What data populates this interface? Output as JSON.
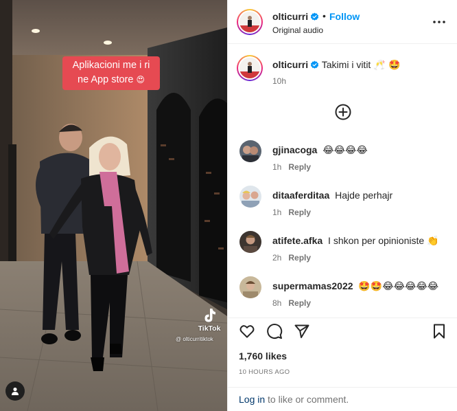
{
  "media": {
    "caption_sticker_line1": "Aplikacioni me i ri",
    "caption_sticker_line2": "ne App store",
    "caption_sticker_emoji": "😍",
    "watermark_brand": "TikTok",
    "watermark_handle": "@ olticurritiktok",
    "user_tag_icon": "person-icon"
  },
  "header": {
    "username": "olticurri",
    "separator": "•",
    "follow_label": "Follow",
    "audio": "Original audio",
    "more_icon": "more-horizontal-icon"
  },
  "caption": {
    "username": "olticurri",
    "text": "Takimi i vitit",
    "emojis": "🥂 🤩",
    "time": "10h"
  },
  "load_more_icon": "plus-circle-icon",
  "comments": [
    {
      "username": "gjinacoga",
      "text": "",
      "emojis": "😂😂😂😂",
      "time": "1h",
      "reply": "Reply"
    },
    {
      "username": "ditaaferditaa",
      "text": "Hajde perhajr",
      "emojis": "",
      "time": "1h",
      "reply": "Reply"
    },
    {
      "username": "atifete.afka",
      "text": "I shkon per opinioniste",
      "emojis": "👏",
      "time": "2h",
      "reply": "Reply"
    },
    {
      "username": "supermamas2022",
      "text": "",
      "emojis": "🤩🤩😂😂😂😂😂",
      "time": "8h",
      "reply": "Reply"
    }
  ],
  "actions": {
    "like_icon": "heart-icon",
    "comment_icon": "comment-icon",
    "share_icon": "paper-plane-icon",
    "save_icon": "bookmark-icon"
  },
  "likes": "1,760 likes",
  "post_time": "10 HOURS AGO",
  "login": {
    "link": "Log in",
    "rest": " to like or comment."
  },
  "colors": {
    "accent": "#0095f6",
    "verified": "#0095f6",
    "sticker": "#e64a52",
    "secondary_text": "#737373",
    "link": "#00376b"
  }
}
